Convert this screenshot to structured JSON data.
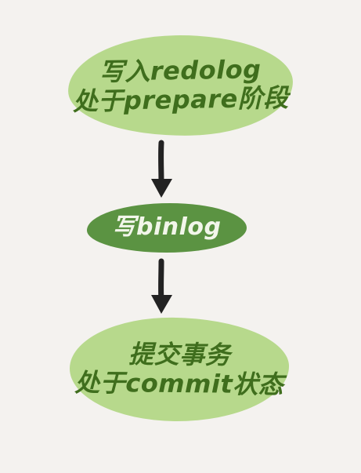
{
  "nodes": [
    {
      "line1": "写入redolog",
      "line2": "处于prepare阶段"
    },
    {
      "line1": "写binlog"
    },
    {
      "line1": "提交事务",
      "line2": "处于commit状态"
    }
  ],
  "colors": {
    "background": "#f4f2ef",
    "light_node": "#b7d98c",
    "light_text": "#3f6e1d",
    "dark_node": "#5b9342",
    "dark_text": "#f2f6ea",
    "arrow": "#222222"
  }
}
